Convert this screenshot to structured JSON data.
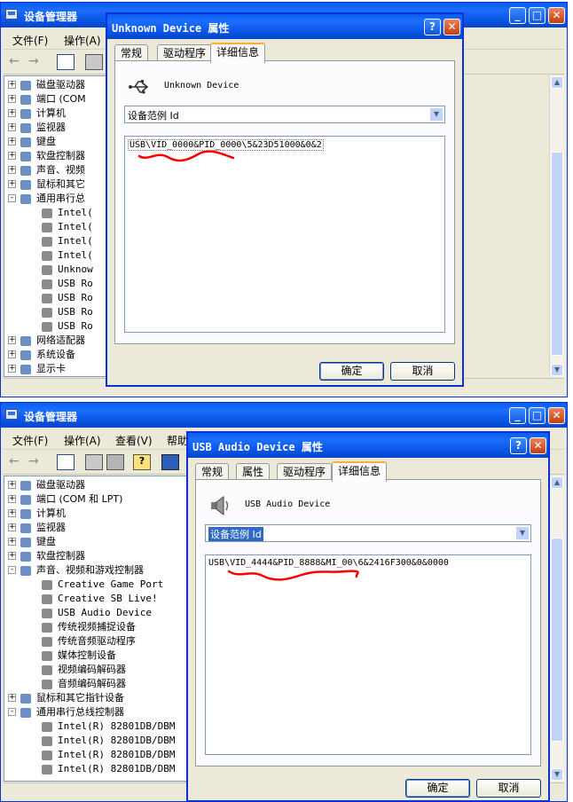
{
  "windows": [
    {
      "title": "设备管理器",
      "menu": [
        "文件(F)",
        "操作(A)"
      ],
      "tree": [
        {
          "label": "磁盘驱动器",
          "level": 0,
          "expand": "+"
        },
        {
          "label": "端口 (COM",
          "level": 0,
          "expand": "+"
        },
        {
          "label": "计算机",
          "level": 0,
          "expand": "+"
        },
        {
          "label": "监视器",
          "level": 0,
          "expand": "+"
        },
        {
          "label": "键盘",
          "level": 0,
          "expand": "+"
        },
        {
          "label": "软盘控制器",
          "level": 0,
          "expand": "+"
        },
        {
          "label": "声音、视频",
          "level": 0,
          "expand": "+"
        },
        {
          "label": "鼠标和其它",
          "level": 0,
          "expand": "+"
        },
        {
          "label": "通用串行总",
          "level": 0,
          "expand": "-"
        },
        {
          "label": "Intel(",
          "level": 1
        },
        {
          "label": "Intel(",
          "level": 1
        },
        {
          "label": "Intel(",
          "level": 1
        },
        {
          "label": "Intel(",
          "level": 1
        },
        {
          "label": "Unknow",
          "level": 1
        },
        {
          "label": "USB Ro",
          "level": 1
        },
        {
          "label": "USB Ro",
          "level": 1
        },
        {
          "label": "USB Ro",
          "level": 1
        },
        {
          "label": "USB Ro",
          "level": 1
        },
        {
          "label": "网络适配器",
          "level": 0,
          "expand": "+"
        },
        {
          "label": "系统设备",
          "level": 0,
          "expand": "+"
        },
        {
          "label": "显示卡",
          "level": 0,
          "expand": "+"
        }
      ],
      "dialog": {
        "title": "Unknown Device 属性",
        "tabs": [
          "常规",
          "驱动程序",
          "详细信息"
        ],
        "device_name": "Unknown Device",
        "property": "设备范例 Id",
        "value": "USB\\VID_0000&PID_0000\\5&23D51000&0&2",
        "ok": "确定",
        "cancel": "取消"
      }
    },
    {
      "title": "设备管理器",
      "menu": [
        "文件(F)",
        "操作(A)",
        "查看(V)",
        "帮助"
      ],
      "tree": [
        {
          "label": "磁盘驱动器",
          "level": 0,
          "expand": "+"
        },
        {
          "label": "端口 (COM 和 LPT)",
          "level": 0,
          "expand": "+"
        },
        {
          "label": "计算机",
          "level": 0,
          "expand": "+"
        },
        {
          "label": "监视器",
          "level": 0,
          "expand": "+"
        },
        {
          "label": "键盘",
          "level": 0,
          "expand": "+"
        },
        {
          "label": "软盘控制器",
          "level": 0,
          "expand": "+"
        },
        {
          "label": "声音、视频和游戏控制器",
          "level": 0,
          "expand": "-"
        },
        {
          "label": "Creative Game Port",
          "level": 1
        },
        {
          "label": "Creative SB Live!",
          "level": 1
        },
        {
          "label": "USB Audio Device",
          "level": 1
        },
        {
          "label": "传统视频捕捉设备",
          "level": 1
        },
        {
          "label": "传统音频驱动程序",
          "level": 1
        },
        {
          "label": "媒体控制设备",
          "level": 1
        },
        {
          "label": "视频编码解码器",
          "level": 1
        },
        {
          "label": "音频编码解码器",
          "level": 1
        },
        {
          "label": "鼠标和其它指针设备",
          "level": 0,
          "expand": "+"
        },
        {
          "label": "通用串行总线控制器",
          "level": 0,
          "expand": "-"
        },
        {
          "label": "Intel(R) 82801DB/DBM",
          "level": 1
        },
        {
          "label": "Intel(R) 82801DB/DBM",
          "level": 1
        },
        {
          "label": "Intel(R) 82801DB/DBM",
          "level": 1
        },
        {
          "label": "Intel(R) 82801DB/DBM",
          "level": 1
        }
      ],
      "dialog": {
        "title": "USB Audio Device 属性",
        "tabs": [
          "常规",
          "属性",
          "驱动程序",
          "详细信息"
        ],
        "device_name": "USB Audio Device",
        "property": "设备范例 Id",
        "value": "USB\\VID_4444&PID_8888&MI_00\\6&2416F300&0&0000",
        "ok": "确定",
        "cancel": "取消"
      }
    }
  ],
  "colors": {
    "titlebar": "#0a56e6",
    "annotation": "#ff0000",
    "selection": "#316ac5"
  }
}
